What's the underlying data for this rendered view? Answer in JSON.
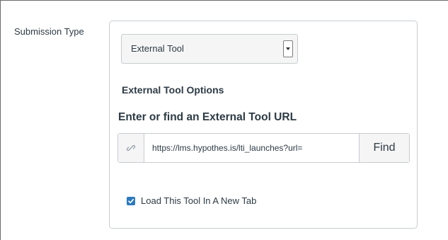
{
  "submission": {
    "label": "Submission Type",
    "selected_type": "External Tool"
  },
  "external_tool": {
    "heading": "External Tool Options",
    "url_heading": "Enter or find an External Tool URL",
    "url_value": "https://lms.hypothes.is/lti_launches?url=",
    "link_icon": "link-icon",
    "find_label": "Find",
    "new_tab_label": "Load This Tool In A New Tab",
    "new_tab_checked": true
  },
  "colors": {
    "text": "#2d3b45",
    "border": "#c7cdd1",
    "addon_bg": "#f5f5f5",
    "checkbox_accent": "#2b7abc"
  }
}
